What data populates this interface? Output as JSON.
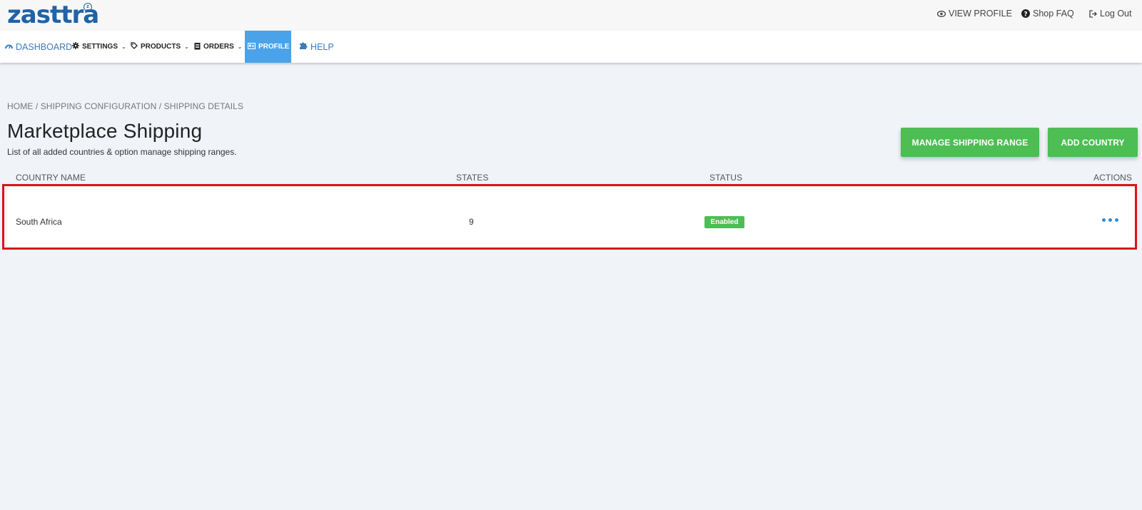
{
  "brand": {
    "logo_text": "zasttra",
    "logo_mark": "z"
  },
  "toplinks": [
    {
      "icon": "eye-icon",
      "label": "VIEW PROFILE"
    },
    {
      "icon": "question-circle-icon",
      "label": "Shop FAQ"
    },
    {
      "icon": "logout-icon",
      "label": "Log Out"
    }
  ],
  "nav": {
    "dashboard": "DASHBOARD",
    "settings": "SETTINGS",
    "products": "PRODUCTS",
    "orders": "ORDERS",
    "profile": "PROFILE",
    "help": "HELP"
  },
  "breadcrumb": "HOME / SHIPPING CONFIGURATION / SHIPPING DETAILS",
  "page": {
    "title": "Marketplace Shipping",
    "subtitle": "List of all added countries & option manage shipping ranges."
  },
  "buttons": {
    "manage_range": "MANAGE SHIPPING RANGE",
    "add_country": "ADD COUNTRY"
  },
  "table": {
    "headers": {
      "country": "COUNTRY NAME",
      "states": "STATES",
      "status": "STATUS",
      "actions": "ACTIONS"
    },
    "rows": [
      {
        "country": "South Africa",
        "states": "9",
        "status": "Enabled"
      }
    ]
  },
  "colors": {
    "brand_blue": "#1f63a8",
    "accent_blue": "#4aa3e8",
    "success_green": "#4cbe53",
    "highlight_red": "#d9131c",
    "page_bg": "#f0f3f8"
  }
}
